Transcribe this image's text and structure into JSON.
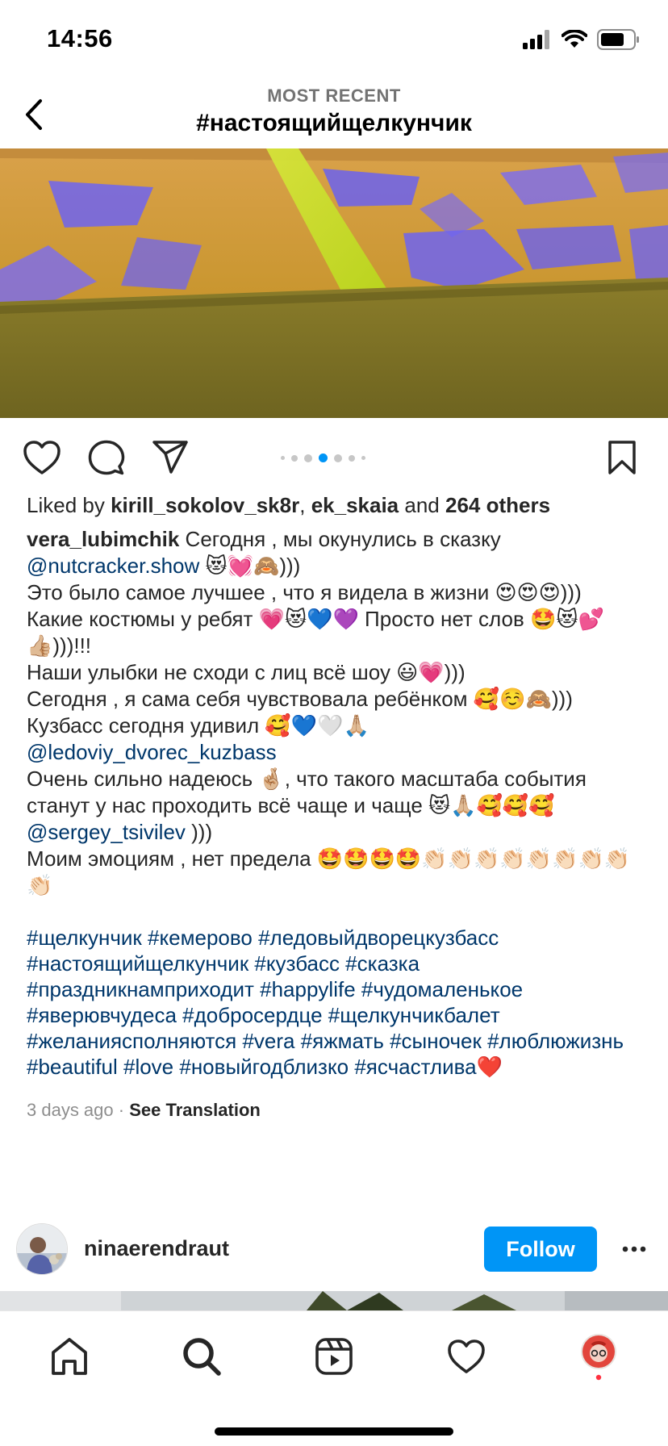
{
  "status_bar": {
    "time": "14:56"
  },
  "header": {
    "subtitle": "MOST RECENT",
    "title": "#настоящийщелкунчик"
  },
  "likes": {
    "prefix": "Liked by",
    "user1": "kirill_sokolov_sk8r",
    "separator": ",",
    "user2": "ek_skaia",
    "and": "and",
    "others": "264 others"
  },
  "caption": {
    "username": "vera_lubimchik",
    "l1": "Сегодня , мы окунулись в сказку",
    "mention1": "@nutcracker.show",
    "l2": "😻💓🙈)))",
    "l3": "Это было самое лучшее , что я видела в жизни 😍😍😍))) Какие костюмы у ребят 💗😻💙💜 Просто нет слов 🤩😻💕👍🏼)))!!!",
    "l4": "Наши улыбки не сходи с лиц всё шоу 😃💗)))",
    "l5": "Сегодня , я сама себя чувствовала ребёнком 🥰☺️🙈)))",
    "l6": "Кузбасс сегодня удивил 🥰💙🤍🙏🏼",
    "mention2": "@ledoviy_dvorec_kuzbass",
    "l7": "Очень сильно надеюсь 🤞🏼, что такого масштаба события станут у нас проходить всё чаще и чаще 😻🙏🏼🥰🥰🥰",
    "mention3": "@sergey_tsivilev",
    "l7b": ")))",
    "l8": "Моим эмоциям , нет предела 🤩🤩🤩🤩👏🏻👏🏻👏🏻👏🏻👏🏻👏🏻👏🏻👏🏻👏🏻"
  },
  "hashtags": "#щелкунчик #кемерово #ледовыйдворецкузбасс #настоящийщелкунчик #кузбасс #сказка #праздникнамприходит #happylife #чудомаленькое #яверювчудеса #добросердце #щелкунчикбалет #желаниясполняются #vera #яжмать #сыночек #люблюжизнь #beautiful #love #новыйгодблизко #ясчастлива❤️",
  "meta": {
    "time": "3 days ago",
    "dot": "·",
    "translate": "See Translation"
  },
  "next_post": {
    "username": "ninaerendraut",
    "follow": "Follow"
  },
  "icons": [
    "back-icon",
    "like-icon",
    "comment-icon",
    "share-icon",
    "save-icon",
    "more-icon",
    "home-icon",
    "search-icon",
    "reels-icon",
    "activity-icon",
    "profile-icon"
  ],
  "carousel": {
    "total": 7,
    "active": 4
  },
  "colors": {
    "accent": "#0095f6",
    "link": "#00376b",
    "notification": "#ff3040"
  }
}
